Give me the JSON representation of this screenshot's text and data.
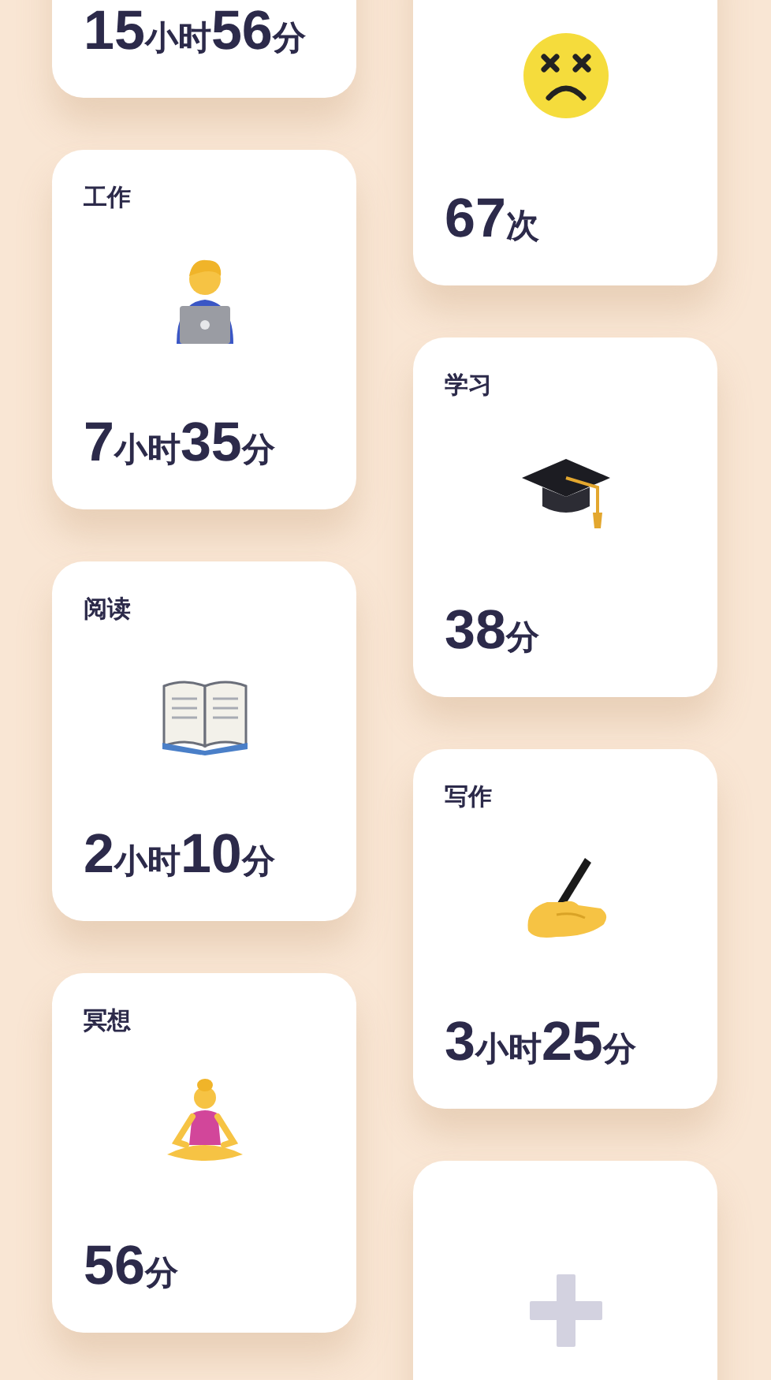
{
  "columns": [
    {
      "cards": [
        {
          "kind": "stat",
          "value": [
            {
              "kind": "number",
              "text": "15"
            },
            {
              "kind": "unit",
              "text": "小时"
            },
            {
              "kind": "number",
              "text": "56"
            },
            {
              "kind": "unit",
              "text": "分"
            }
          ]
        },
        {
          "kind": "stat",
          "label": "工作",
          "value": [
            {
              "kind": "number",
              "text": "7"
            },
            {
              "kind": "unit",
              "text": "小时"
            },
            {
              "kind": "number",
              "text": "35"
            },
            {
              "kind": "unit",
              "text": "分"
            }
          ]
        },
        {
          "kind": "stat",
          "label": "阅读",
          "value": [
            {
              "kind": "number",
              "text": "2"
            },
            {
              "kind": "unit",
              "text": "小时"
            },
            {
              "kind": "number",
              "text": "10"
            },
            {
              "kind": "unit",
              "text": "分"
            }
          ]
        },
        {
          "kind": "stat",
          "label": "冥想",
          "value": [
            {
              "kind": "number",
              "text": "56"
            },
            {
              "kind": "unit",
              "text": "分"
            }
          ]
        }
      ]
    },
    {
      "cards": [
        {
          "kind": "stat",
          "value": [
            {
              "kind": "number",
              "text": "67"
            },
            {
              "kind": "unit",
              "text": "次"
            }
          ]
        },
        {
          "kind": "stat",
          "label": "学习",
          "value": [
            {
              "kind": "number",
              "text": "38"
            },
            {
              "kind": "unit",
              "text": "分"
            }
          ]
        },
        {
          "kind": "stat",
          "label": "写作",
          "value": [
            {
              "kind": "number",
              "text": "3"
            },
            {
              "kind": "unit",
              "text": "小时"
            },
            {
              "kind": "number",
              "text": "25"
            },
            {
              "kind": "unit",
              "text": "分"
            }
          ]
        },
        {
          "kind": "add"
        }
      ]
    }
  ]
}
